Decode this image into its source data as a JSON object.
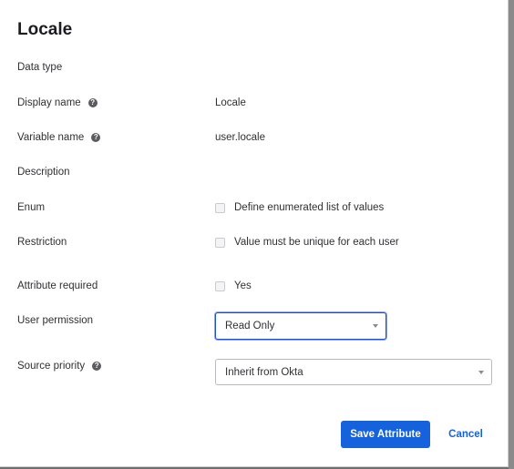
{
  "dialog": {
    "title": "Locale"
  },
  "fields": {
    "data_type": {
      "label": "Data type"
    },
    "display_name": {
      "label": "Display name",
      "help_icon": "?",
      "value": "Locale"
    },
    "variable_name": {
      "label": "Variable name",
      "help_icon": "?",
      "value": "user.locale"
    },
    "description": {
      "label": "Description"
    },
    "enum": {
      "label": "Enum",
      "checkbox_label": "Define enumerated list of values",
      "checked": false
    },
    "restriction": {
      "label": "Restriction",
      "checkbox_label": "Value must be unique for each user",
      "checked": false
    },
    "attribute_required": {
      "label": "Attribute required",
      "checkbox_label": "Yes",
      "checked": false
    },
    "user_permission": {
      "label": "User permission",
      "selected": "Read Only"
    },
    "source_priority": {
      "label": "Source priority",
      "help_icon": "?",
      "selected": "Inherit from Okta"
    }
  },
  "actions": {
    "save_label": "Save Attribute",
    "cancel_label": "Cancel"
  },
  "colors": {
    "primary": "#1662dd",
    "focus_border": "#1f4fd1"
  }
}
